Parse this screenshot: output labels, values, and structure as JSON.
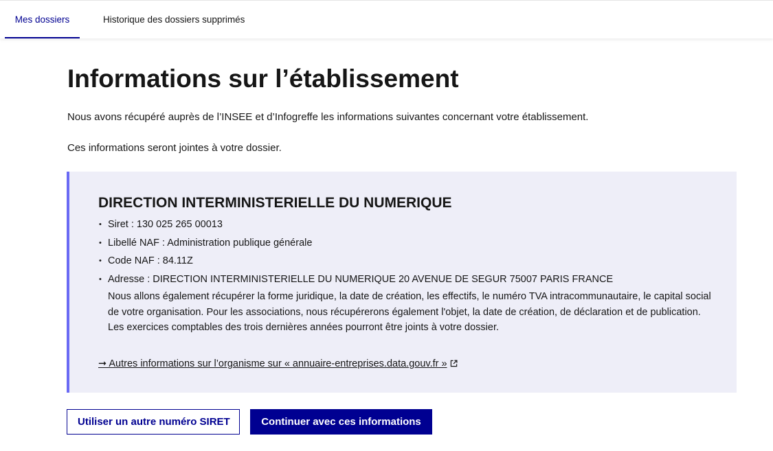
{
  "tabs": [
    {
      "label": "Mes dossiers",
      "active": true
    },
    {
      "label": "Historique des dossiers supprimés",
      "active": false
    }
  ],
  "page": {
    "title": "Informations sur l’établissement",
    "intro_1": "Nous avons récupéré auprès de l’INSEE et d’Infogreffe les informations suivantes concernant votre établissement.",
    "intro_2": "Ces informations seront jointes à votre dossier."
  },
  "establishment": {
    "name": "DIRECTION INTERMINISTERIELLE DU NUMERIQUE",
    "details": [
      "Siret : 130 025 265 00013",
      "Libellé NAF : Administration publique générale",
      "Code NAF : 84.11Z",
      "Adresse : DIRECTION INTERMINISTERIELLE DU NUMERIQUE 20 AVENUE DE SEGUR 75007 PARIS FRANCE"
    ],
    "notice_1": "Nous allons également récupérer la forme juridique, la date de création, les effectifs, le numéro TVA intracommunautaire, le capital social de votre organisation. Pour les associations, nous récupérerons également l'objet, la date de création, de déclaration et de publication.",
    "notice_2": "Les exercices comptables des trois dernières années pourront être joints à votre dossier.",
    "link_text": "➞ Autres informations sur l’organisme sur « annuaire-entreprises.data.gouv.fr »",
    "link_icon": "external-link-icon"
  },
  "actions": {
    "secondary_label": "Utiliser un autre numéro SIRET",
    "primary_label": "Continuer avec ces informations"
  },
  "colors": {
    "brand_blue": "#000091",
    "callout_bg": "#eeeef8",
    "callout_border": "#6a6af4",
    "text": "#161616"
  }
}
